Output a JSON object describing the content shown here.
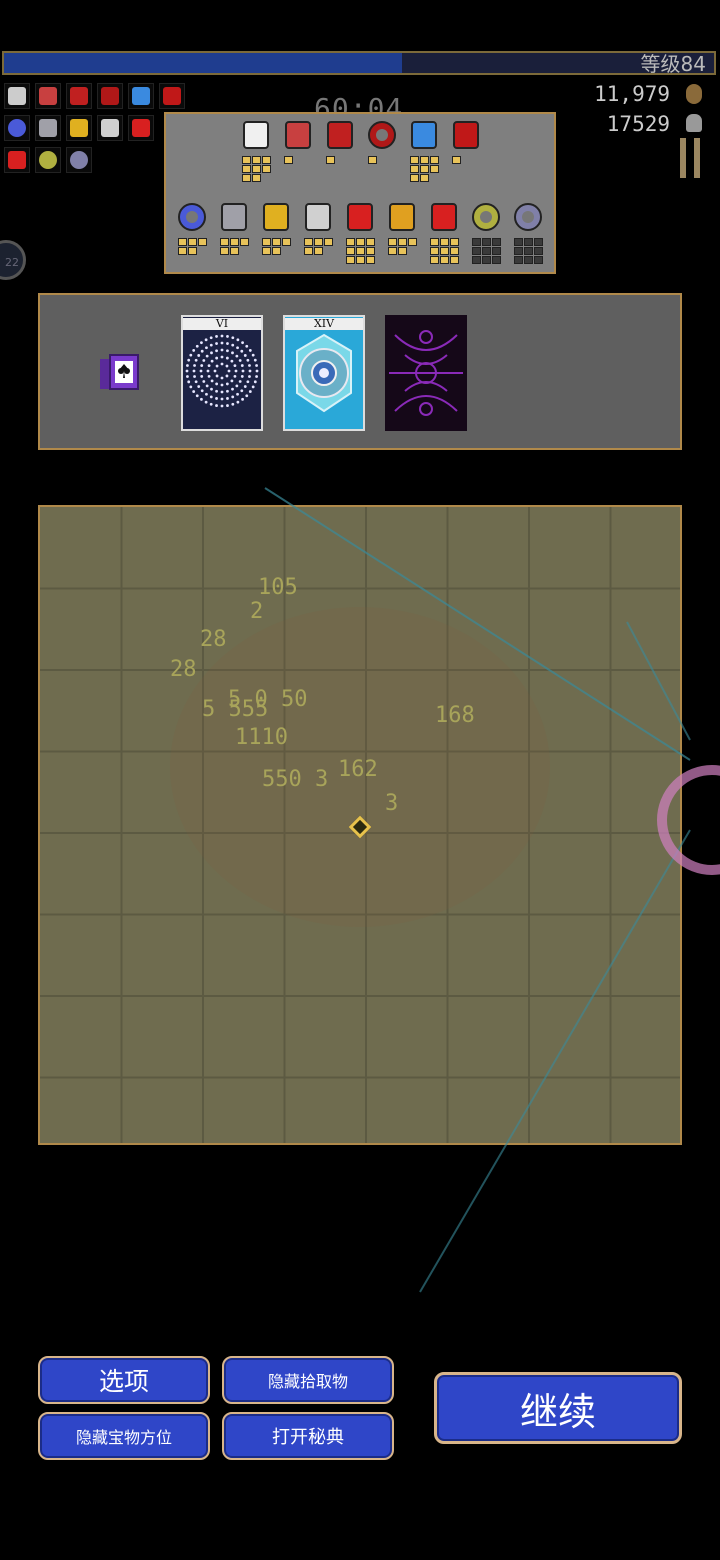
{
  "hud": {
    "level": "等级84",
    "xp_progress": 0.56,
    "timer": "60:04",
    "gold": "11,979",
    "kills": "17529",
    "level_badge": "22",
    "weapon_icons": [
      "peachone-icon",
      "diamond-icon",
      "king-bible-icon",
      "fire-wand-icon",
      "magic-wand-icon",
      "cloak-icon"
    ],
    "passive_icons": [
      "orb-icon",
      "armor-icon",
      "cage-icon",
      "heart-icon",
      "arrow-icon"
    ],
    "extra_icons": [
      "arrow-icon",
      "gold-ring-icon",
      "silver-ring-icon"
    ]
  },
  "inventory": {
    "weapons": [
      {
        "icon": "dove-icon",
        "color": "#f0f0f0",
        "levels": 8
      },
      {
        "icon": "diamond-icon",
        "color": "#c84040",
        "levels": 1
      },
      {
        "icon": "book-icon",
        "color": "#c02020",
        "levels": 1
      },
      {
        "icon": "spiral-icon",
        "color": "#b01818",
        "levels": 1
      },
      {
        "icon": "wand-icon",
        "color": "#3a8ae0",
        "levels": 8
      },
      {
        "icon": "cloak-icon",
        "color": "#c01818",
        "levels": 1
      }
    ],
    "passives": [
      {
        "icon": "orb-icon",
        "color": "#4a5ad8",
        "levels": 5
      },
      {
        "icon": "armor-icon",
        "color": "#a0a0a8",
        "levels": 5
      },
      {
        "icon": "cage-icon",
        "color": "#e0b020",
        "levels": 5
      },
      {
        "icon": "heart-icon",
        "color": "#d0d0d0",
        "levels": 5
      },
      {
        "icon": "red-arrow-icon",
        "color": "#d82020",
        "levels": 9
      },
      {
        "icon": "crown-icon",
        "color": "#e0a020",
        "levels": 5
      },
      {
        "icon": "red-cross-icon",
        "color": "#d82020",
        "levels": 9
      },
      {
        "icon": "gold-ring-icon",
        "color": "#b0b040",
        "levels": 9,
        "filled": 0
      },
      {
        "icon": "silver-ring-icon",
        "color": "#8080a8",
        "levels": 9,
        "filled": 0
      }
    ]
  },
  "arcana": {
    "cards": [
      {
        "numeral": "VI",
        "style": "dots"
      },
      {
        "numeral": "XIV",
        "style": "mandala"
      },
      {
        "numeral": "",
        "style": "hidden"
      }
    ]
  },
  "map": {
    "damage_numbers": [
      {
        "text": "105"
      },
      {
        "text": "2"
      },
      {
        "text": "28"
      },
      {
        "text": "28"
      },
      {
        "text": "5 0 50"
      },
      {
        "text": "5 555"
      },
      {
        "text": "1110"
      },
      {
        "text": "162"
      },
      {
        "text": "550 3"
      },
      {
        "text": "168"
      },
      {
        "text": "3"
      }
    ]
  },
  "buttons": {
    "options": "选项",
    "hide_pickups": "隐藏拾取物",
    "hide_treasure": "隐藏宝物方位",
    "open_codex": "打开秘典",
    "continue": "继续"
  },
  "colors": {
    "panel_border": "#b0894a",
    "button_blue": "#2f46c8",
    "xp_fill": "#1f3d8f"
  }
}
